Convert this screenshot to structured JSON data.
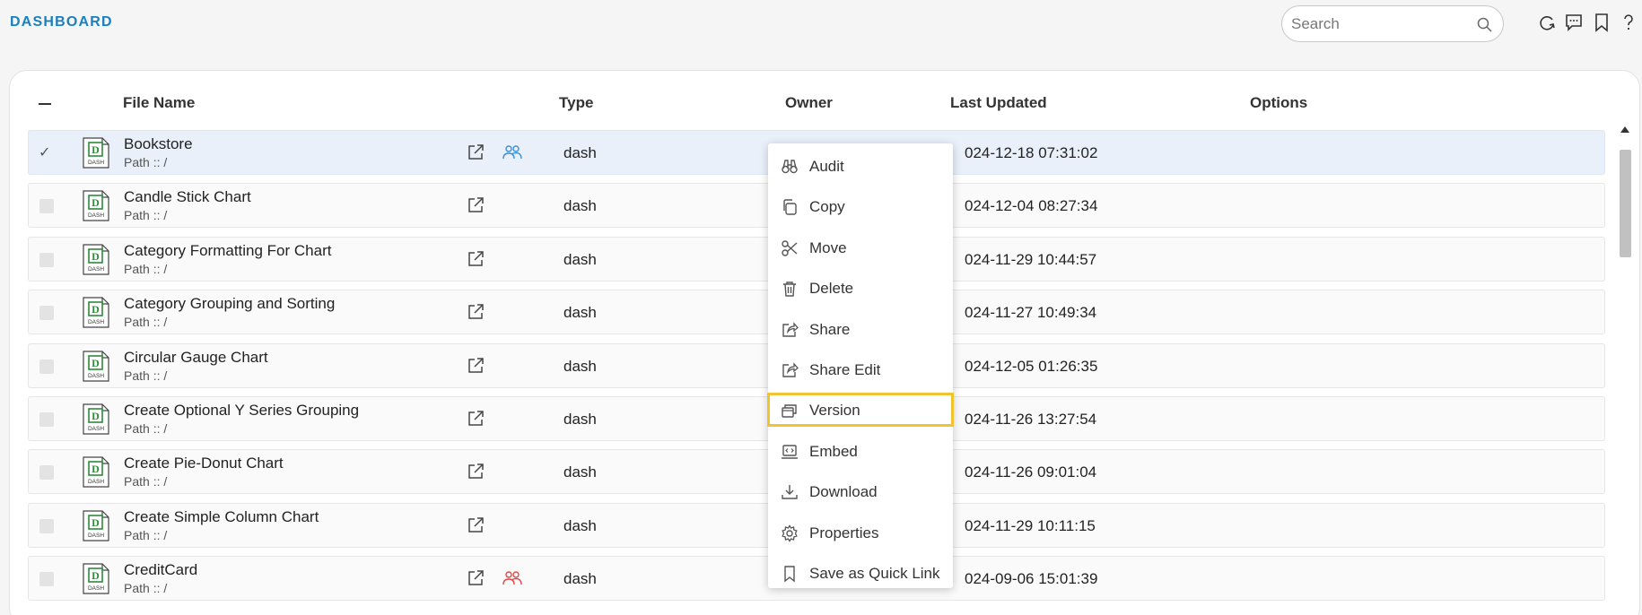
{
  "header": {
    "title": "DASHBOARD",
    "search_placeholder": "Search",
    "icons": [
      "refresh-icon",
      "chat-icon",
      "bookmark-icon",
      "help-icon"
    ]
  },
  "table": {
    "columns": {
      "file_name": "File Name",
      "type": "Type",
      "owner": "Owner",
      "last_updated": "Last Updated",
      "options": "Options"
    },
    "rows": [
      {
        "name": "Bookstore",
        "path": "Path :: /",
        "type": "dash",
        "date": "024-12-18 07:31:02",
        "selected": true,
        "shared": "blue"
      },
      {
        "name": "Candle Stick Chart",
        "path": "Path :: /",
        "type": "dash",
        "date": "024-12-04 08:27:34",
        "selected": false,
        "shared": ""
      },
      {
        "name": "Category Formatting For Chart",
        "path": "Path :: /",
        "type": "dash",
        "date": "024-11-29 10:44:57",
        "selected": false,
        "shared": ""
      },
      {
        "name": "Category Grouping and Sorting",
        "path": "Path :: /",
        "type": "dash",
        "date": "024-11-27 10:49:34",
        "selected": false,
        "shared": ""
      },
      {
        "name": "Circular Gauge Chart",
        "path": "Path :: /",
        "type": "dash",
        "date": "024-12-05 01:26:35",
        "selected": false,
        "shared": ""
      },
      {
        "name": "Create Optional Y Series Grouping",
        "path": "Path :: /",
        "type": "dash",
        "date": "024-11-26 13:27:54",
        "selected": false,
        "shared": ""
      },
      {
        "name": "Create Pie-Donut Chart",
        "path": "Path :: /",
        "type": "dash",
        "date": "024-11-26 09:01:04",
        "selected": false,
        "shared": ""
      },
      {
        "name": "Create Simple Column Chart",
        "path": "Path :: /",
        "type": "dash",
        "date": "024-11-29 10:11:15",
        "selected": false,
        "shared": ""
      },
      {
        "name": "CreditCard",
        "path": "Path :: /",
        "type": "dash",
        "date": "024-09-06 15:01:39",
        "selected": false,
        "shared": "red"
      }
    ],
    "file_icon_text": "DASH"
  },
  "context_menu": {
    "items": [
      {
        "label": "Audit",
        "icon": "binoculars-icon",
        "highlighted": false
      },
      {
        "label": "Copy",
        "icon": "copy-icon",
        "highlighted": false
      },
      {
        "label": "Move",
        "icon": "scissors-icon",
        "highlighted": false
      },
      {
        "label": "Delete",
        "icon": "trash-icon",
        "highlighted": false
      },
      {
        "label": "Share",
        "icon": "share-icon",
        "highlighted": false
      },
      {
        "label": "Share Edit",
        "icon": "share-edit-icon",
        "highlighted": false
      },
      {
        "label": "Version",
        "icon": "version-icon",
        "highlighted": true
      },
      {
        "label": "Embed",
        "icon": "embed-icon",
        "highlighted": false
      },
      {
        "label": "Download",
        "icon": "download-icon",
        "highlighted": false
      },
      {
        "label": "Properties",
        "icon": "gear-icon",
        "highlighted": false
      },
      {
        "label": "Save as Quick Link",
        "icon": "bookmark-icon",
        "highlighted": false
      }
    ]
  },
  "colors": {
    "brand": "#1a7fbf",
    "highlight_border": "#f2c330",
    "selected_row": "#e9f0fa",
    "shared_blue": "#3a8fd6",
    "shared_red": "#e04848",
    "file_icon_green": "#2e8b3a"
  }
}
